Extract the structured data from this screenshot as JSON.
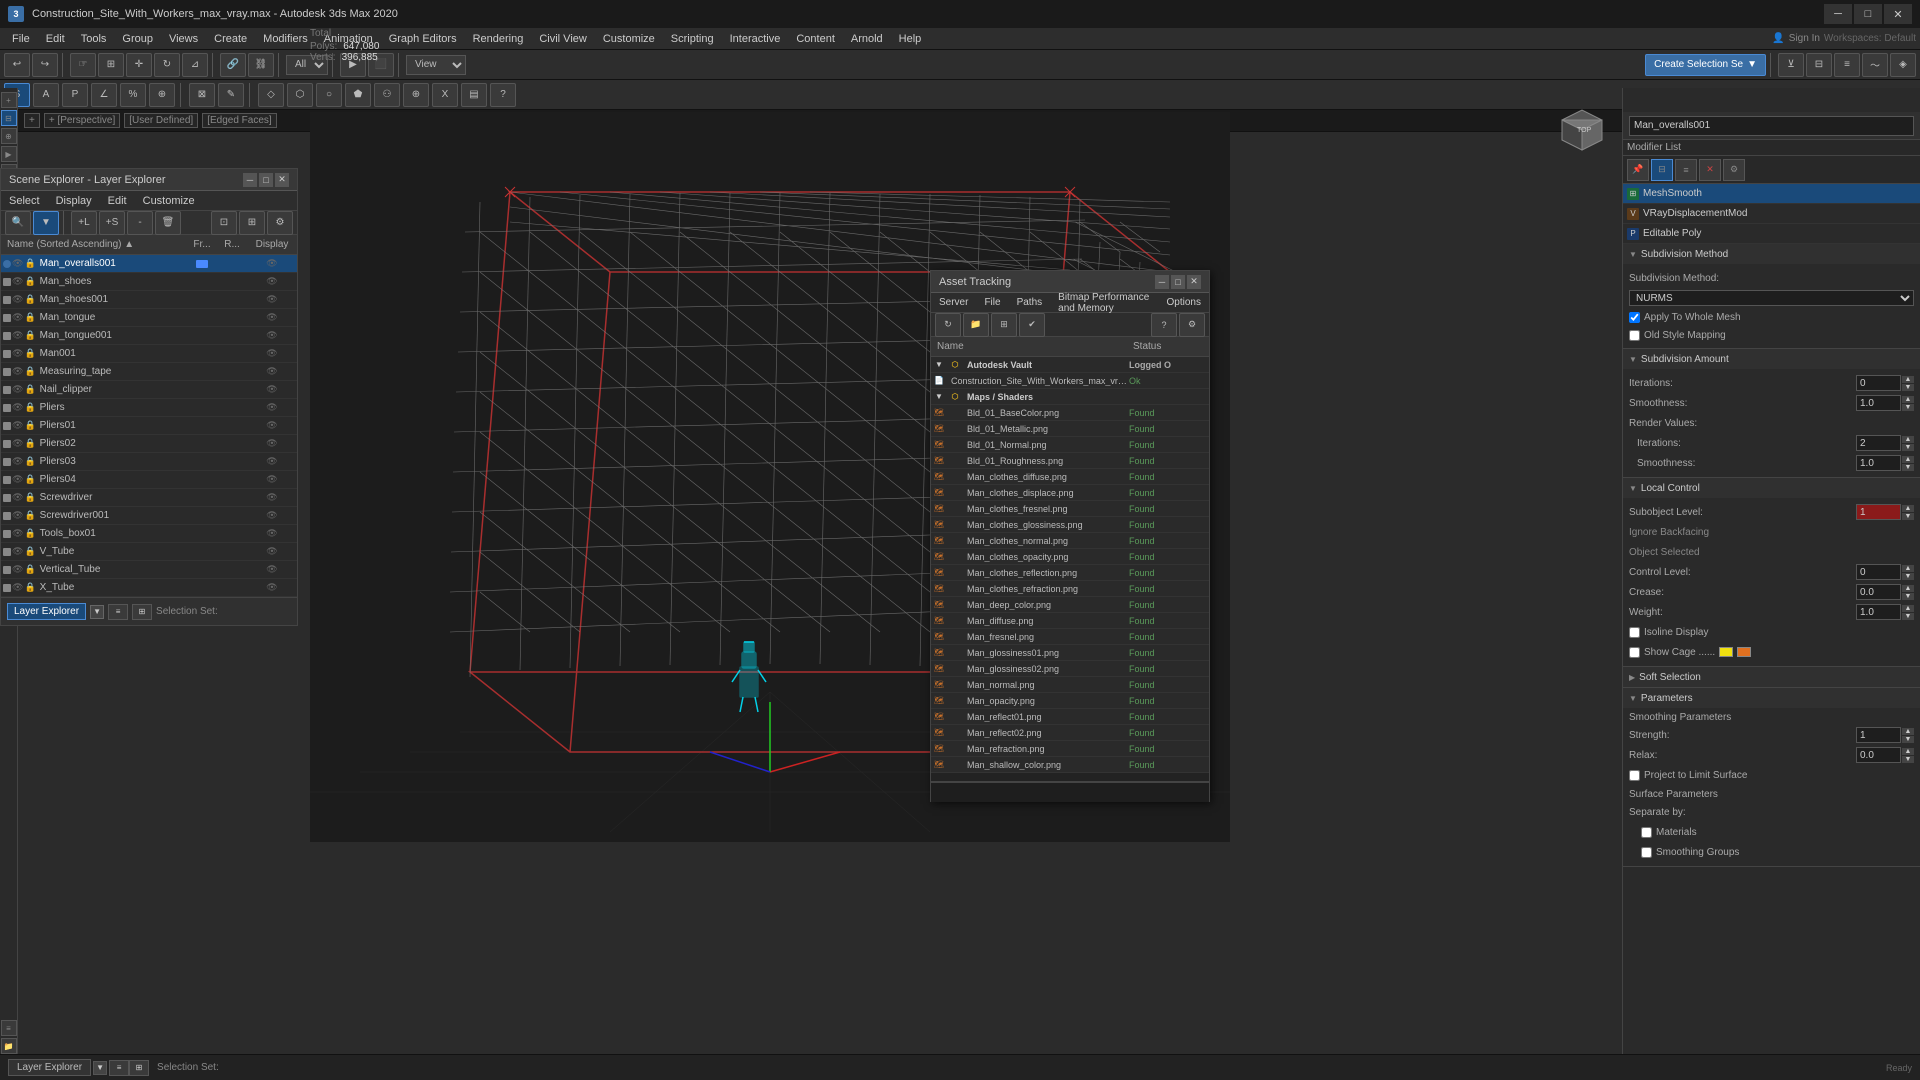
{
  "app": {
    "title": "Construction_Site_With_Workers_max_vray.max - Autodesk 3ds Max 2020",
    "icon": "3"
  },
  "titleBar": {
    "minimize": "─",
    "maximize": "□",
    "close": "✕"
  },
  "menuBar": {
    "items": [
      "File",
      "Edit",
      "Tools",
      "Group",
      "Views",
      "Create",
      "Modifiers",
      "Animation",
      "Graph Editors",
      "Rendering",
      "Civil View",
      "Customize",
      "Scripting",
      "Interactive",
      "Content",
      "Arnold",
      "Help"
    ]
  },
  "toolbar1": {
    "undo": "↩",
    "redo": "↪",
    "select": "↖",
    "viewLabel": "View",
    "createSelBtn": "Create Selection Se"
  },
  "viewport": {
    "label1": "+ [Perspective]",
    "label2": "[User Defined]",
    "label3": "[Edged Faces]"
  },
  "stats": {
    "polyLabel": "Polys:",
    "polyValue": "647,080",
    "vertLabel": "Verts:",
    "vertValue": "396,885",
    "totalLabel": "Total"
  },
  "sceneExplorer": {
    "title": "Scene Explorer - Layer Explorer",
    "menus": [
      "Select",
      "Display",
      "Edit",
      "Customize"
    ],
    "columnHeaders": [
      "Name (Sorted Ascending)",
      "Fr...",
      "R...",
      "Display"
    ],
    "items": [
      {
        "name": "Man_overalls001",
        "selected": true,
        "type": "mesh"
      },
      {
        "name": "Man_shoes",
        "selected": false,
        "type": "mesh"
      },
      {
        "name": "Man_shoes001",
        "selected": false,
        "type": "mesh"
      },
      {
        "name": "Man_tongue",
        "selected": false,
        "type": "mesh"
      },
      {
        "name": "Man_tongue001",
        "selected": false,
        "type": "mesh"
      },
      {
        "name": "Man001",
        "selected": false,
        "type": "mesh"
      },
      {
        "name": "Measuring_tape",
        "selected": false,
        "type": "mesh"
      },
      {
        "name": "Nail_clipper",
        "selected": false,
        "type": "mesh"
      },
      {
        "name": "Pliers",
        "selected": false,
        "type": "mesh"
      },
      {
        "name": "Pliers01",
        "selected": false,
        "type": "mesh"
      },
      {
        "name": "Pliers02",
        "selected": false,
        "type": "mesh"
      },
      {
        "name": "Pliers03",
        "selected": false,
        "type": "mesh"
      },
      {
        "name": "Pliers04",
        "selected": false,
        "type": "mesh"
      },
      {
        "name": "Screwdriver",
        "selected": false,
        "type": "mesh"
      },
      {
        "name": "Screwdriver001",
        "selected": false,
        "type": "mesh"
      },
      {
        "name": "Tools_box01",
        "selected": false,
        "type": "mesh"
      },
      {
        "name": "V_Tube",
        "selected": false,
        "type": "mesh"
      },
      {
        "name": "Vertical_Tube",
        "selected": false,
        "type": "mesh"
      },
      {
        "name": "X_Tube",
        "selected": false,
        "type": "mesh"
      }
    ],
    "footer": {
      "label": "Layer Explorer",
      "selectionSet": "Selection Set:"
    }
  },
  "assetTracking": {
    "title": "Asset Tracking",
    "menus": [
      "Server",
      "File",
      "Paths",
      "Bitmap Performance and Memory",
      "Options"
    ],
    "columnHeaders": [
      "Name",
      "Status"
    ],
    "groups": [
      {
        "name": "Autodesk Vault",
        "status": "Logged O",
        "files": [
          {
            "name": "Construction_Site_With_Workers_max_vray.max",
            "status": "Ok",
            "isFile": true
          }
        ]
      },
      {
        "name": "Maps / Shaders",
        "status": "",
        "files": [
          {
            "name": "Bld_01_BaseColor.png",
            "status": "Found"
          },
          {
            "name": "Bld_01_Metallic.png",
            "status": "Found"
          },
          {
            "name": "Bld_01_Normal.png",
            "status": "Found"
          },
          {
            "name": "Bld_01_Roughness.png",
            "status": "Found"
          },
          {
            "name": "Man_clothes_diffuse.png",
            "status": "Found"
          },
          {
            "name": "Man_clothes_displace.png",
            "status": "Found"
          },
          {
            "name": "Man_clothes_fresnel.png",
            "status": "Found"
          },
          {
            "name": "Man_clothes_glossiness.png",
            "status": "Found"
          },
          {
            "name": "Man_clothes_normal.png",
            "status": "Found"
          },
          {
            "name": "Man_clothes_opacity.png",
            "status": "Found"
          },
          {
            "name": "Man_clothes_reflection.png",
            "status": "Found"
          },
          {
            "name": "Man_clothes_refraction.png",
            "status": "Found"
          },
          {
            "name": "Man_deep_color.png",
            "status": "Found"
          },
          {
            "name": "Man_diffuse.png",
            "status": "Found"
          },
          {
            "name": "Man_fresnel.png",
            "status": "Found"
          },
          {
            "name": "Man_glossiness01.png",
            "status": "Found"
          },
          {
            "name": "Man_glossiness02.png",
            "status": "Found"
          },
          {
            "name": "Man_normal.png",
            "status": "Found"
          },
          {
            "name": "Man_opacity.png",
            "status": "Found"
          },
          {
            "name": "Man_reflect01.png",
            "status": "Found"
          },
          {
            "name": "Man_reflect02.png",
            "status": "Found"
          },
          {
            "name": "Man_refraction.png",
            "status": "Found"
          },
          {
            "name": "Man_shallow_color.png",
            "status": "Found"
          }
        ]
      }
    ]
  },
  "rightPanel": {
    "objectName": "Man_overalls001",
    "modifierList": "Modifier List",
    "modifiers": [
      {
        "name": "MeshSmooth",
        "active": true
      },
      {
        "name": "VRayDisplacementMod",
        "active": false
      },
      {
        "name": "Editable Poly",
        "active": false
      }
    ],
    "sections": {
      "subdivisionMethod": {
        "title": "Subdivision Method",
        "method": {
          "label": "Subdivision Method:",
          "value": "NURMS"
        },
        "applyToWholeMesh": "Apply To Whole Mesh",
        "oldStyleMapping": "Old Style Mapping"
      },
      "subdivisionAmount": {
        "title": "Subdivision Amount",
        "iterationsLabel": "Iterations:",
        "iterationsValue": "0",
        "smoothnessLabel": "Smoothness:",
        "smoothnessValue": "1.0",
        "renderValuesLabel": "Render Values:",
        "renderIterations": "2",
        "renderSmoothness": "1.0"
      },
      "localControl": {
        "title": "Local Control",
        "subobjectLevel": "Subobject Level:",
        "subobjectValue": "1",
        "ignoreBackfacing": "Ignore Backfacing",
        "objectSelected": "Object Selected",
        "controlLevel": "Control Level:",
        "controlValue": "0",
        "crease": "Crease:",
        "creaseValue": "0.0",
        "weight": "Weight:",
        "weightValue": "1.0",
        "isolineDisplay": "Isoline Display",
        "showCage": "Show Cage ......",
        "cageColor1": "#f0e010",
        "cageColor2": "#e07020"
      },
      "softSelection": {
        "title": "Soft Selection"
      },
      "parameters": {
        "title": "Parameters",
        "smoothingParams": "Smoothing Parameters",
        "strengthLabel": "Strength:",
        "strengthValue": "1",
        "relaxLabel": "Relax:",
        "relaxValue": "0.0",
        "projectToLimitSurface": "Project to Limit Surface",
        "surfaceParams": "Surface Parameters",
        "separateBy": "Separate by:",
        "materials": "Materials",
        "smoothingGroups": "Smoothing Groups"
      }
    }
  },
  "statusBar": {
    "layerLabel": "Layer Explorer",
    "selectionSet": "Selection Set:"
  }
}
